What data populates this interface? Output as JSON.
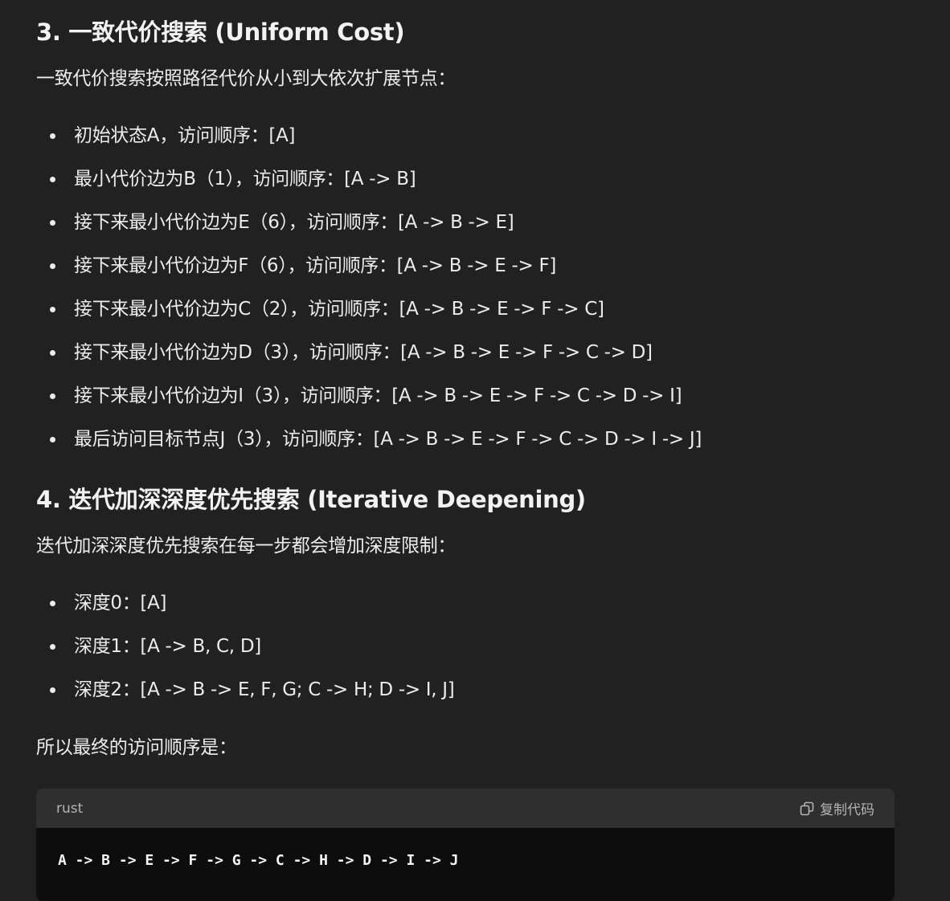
{
  "uniform_cost": {
    "heading": "3. 一致代价搜索 (Uniform Cost)",
    "intro": "一致代价搜索按照路径代价从小到大依次扩展节点：",
    "steps": [
      "初始状态A，访问顺序：[A]",
      "最小代价边为B（1），访问顺序：[A -> B]",
      "接下来最小代价边为E（6），访问顺序：[A -> B -> E]",
      "接下来最小代价边为F（6），访问顺序：[A -> B -> E -> F]",
      "接下来最小代价边为C（2），访问顺序：[A -> B -> E -> F -> C]",
      "接下来最小代价边为D（3），访问顺序：[A -> B -> E -> F -> C -> D]",
      "接下来最小代价边为I（3），访问顺序：[A -> B -> E -> F -> C -> D -> I]",
      "最后访问目标节点J（3），访问顺序：[A -> B -> E -> F -> C -> D -> I -> J]"
    ]
  },
  "iterative_deepening": {
    "heading": "4. 迭代加深深度优先搜索 (Iterative Deepening)",
    "intro": "迭代加深深度优先搜索在每一步都会增加深度限制：",
    "steps": [
      "深度0：[A]",
      "深度1：[A -> B, C, D]",
      "深度2：[A -> B -> E, F, G; C -> H; D -> I, J]"
    ],
    "conclusion": "所以最终的访问顺序是："
  },
  "code_block": {
    "language": "rust",
    "copy_label": "复制代码",
    "copy_icon": "copy-icon",
    "code": "A -> B -> E -> F -> G -> C -> H -> D -> I -> J"
  }
}
